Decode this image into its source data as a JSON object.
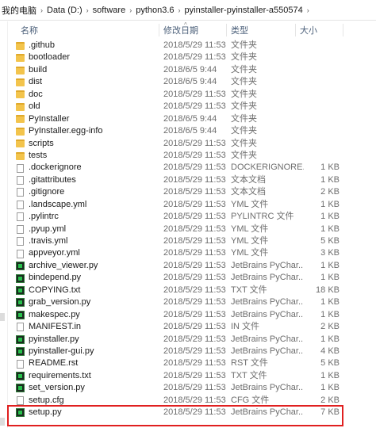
{
  "breadcrumb": [
    "我的电脑",
    "Data (D:)",
    "software",
    "python3.6",
    "pyinstaller-pyinstaller-a550574"
  ],
  "columns": {
    "name": "名称",
    "date": "修改日期",
    "type": "类型",
    "size": "大小"
  },
  "files": [
    {
      "name": ".github",
      "date": "2018/5/29 11:53",
      "type": "文件夹",
      "size": "",
      "icon": "folder-icon"
    },
    {
      "name": "bootloader",
      "date": "2018/5/29 11:53",
      "type": "文件夹",
      "size": "",
      "icon": "folder-icon"
    },
    {
      "name": "build",
      "date": "2018/6/5 9:44",
      "type": "文件夹",
      "size": "",
      "icon": "folder-icon"
    },
    {
      "name": "dist",
      "date": "2018/6/5 9:44",
      "type": "文件夹",
      "size": "",
      "icon": "folder-icon"
    },
    {
      "name": "doc",
      "date": "2018/5/29 11:53",
      "type": "文件夹",
      "size": "",
      "icon": "folder-icon"
    },
    {
      "name": "old",
      "date": "2018/5/29 11:53",
      "type": "文件夹",
      "size": "",
      "icon": "folder-icon"
    },
    {
      "name": "PyInstaller",
      "date": "2018/6/5 9:44",
      "type": "文件夹",
      "size": "",
      "icon": "folder-icon"
    },
    {
      "name": "PyInstaller.egg-info",
      "date": "2018/6/5 9:44",
      "type": "文件夹",
      "size": "",
      "icon": "folder-icon"
    },
    {
      "name": "scripts",
      "date": "2018/5/29 11:53",
      "type": "文件夹",
      "size": "",
      "icon": "folder-icon"
    },
    {
      "name": "tests",
      "date": "2018/5/29 11:53",
      "type": "文件夹",
      "size": "",
      "icon": "folder-icon"
    },
    {
      "name": ".dockerignore",
      "date": "2018/5/29 11:53",
      "type": "DOCKERIGNORE...",
      "size": "1 KB",
      "icon": "file-icon"
    },
    {
      "name": ".gitattributes",
      "date": "2018/5/29 11:53",
      "type": "文本文档",
      "size": "1 KB",
      "icon": "file-icon"
    },
    {
      "name": ".gitignore",
      "date": "2018/5/29 11:53",
      "type": "文本文档",
      "size": "2 KB",
      "icon": "file-icon"
    },
    {
      "name": ".landscape.yml",
      "date": "2018/5/29 11:53",
      "type": "YML 文件",
      "size": "1 KB",
      "icon": "file-icon"
    },
    {
      "name": ".pylintrc",
      "date": "2018/5/29 11:53",
      "type": "PYLINTRC 文件",
      "size": "1 KB",
      "icon": "file-icon"
    },
    {
      "name": ".pyup.yml",
      "date": "2018/5/29 11:53",
      "type": "YML 文件",
      "size": "1 KB",
      "icon": "file-icon"
    },
    {
      "name": ".travis.yml",
      "date": "2018/5/29 11:53",
      "type": "YML 文件",
      "size": "5 KB",
      "icon": "file-icon"
    },
    {
      "name": "appveyor.yml",
      "date": "2018/5/29 11:53",
      "type": "YML 文件",
      "size": "3 KB",
      "icon": "file-icon"
    },
    {
      "name": "archive_viewer.py",
      "date": "2018/5/29 11:53",
      "type": "JetBrains PyChar...",
      "size": "1 KB",
      "icon": "python-file-icon"
    },
    {
      "name": "bindepend.py",
      "date": "2018/5/29 11:53",
      "type": "JetBrains PyChar...",
      "size": "1 KB",
      "icon": "python-file-icon"
    },
    {
      "name": "COPYING.txt",
      "date": "2018/5/29 11:53",
      "type": "TXT 文件",
      "size": "18 KB",
      "icon": "python-file-icon"
    },
    {
      "name": "grab_version.py",
      "date": "2018/5/29 11:53",
      "type": "JetBrains PyChar...",
      "size": "1 KB",
      "icon": "python-file-icon"
    },
    {
      "name": "makespec.py",
      "date": "2018/5/29 11:53",
      "type": "JetBrains PyChar...",
      "size": "1 KB",
      "icon": "python-file-icon"
    },
    {
      "name": "MANIFEST.in",
      "date": "2018/5/29 11:53",
      "type": "IN 文件",
      "size": "2 KB",
      "icon": "file-icon"
    },
    {
      "name": "pyinstaller.py",
      "date": "2018/5/29 11:53",
      "type": "JetBrains PyChar...",
      "size": "1 KB",
      "icon": "python-file-icon"
    },
    {
      "name": "pyinstaller-gui.py",
      "date": "2018/5/29 11:53",
      "type": "JetBrains PyChar...",
      "size": "4 KB",
      "icon": "python-file-icon"
    },
    {
      "name": "README.rst",
      "date": "2018/5/29 11:53",
      "type": "RST 文件",
      "size": "5 KB",
      "icon": "file-icon"
    },
    {
      "name": "requirements.txt",
      "date": "2018/5/29 11:53",
      "type": "TXT 文件",
      "size": "1 KB",
      "icon": "python-file-icon"
    },
    {
      "name": "set_version.py",
      "date": "2018/5/29 11:53",
      "type": "JetBrains PyChar...",
      "size": "1 KB",
      "icon": "python-file-icon"
    },
    {
      "name": "setup.cfg",
      "date": "2018/5/29 11:53",
      "type": "CFG 文件",
      "size": "2 KB",
      "icon": "file-icon"
    },
    {
      "name": "setup.py",
      "date": "2018/5/29 11:53",
      "type": "JetBrains PyChar...",
      "size": "7 KB",
      "icon": "python-file-icon",
      "highlighted": true
    }
  ],
  "colors": {
    "highlight_border": "#e02020",
    "folder": "#f3c44c",
    "header_text": "#4c607a",
    "secondary_text": "#6d6d6d"
  }
}
